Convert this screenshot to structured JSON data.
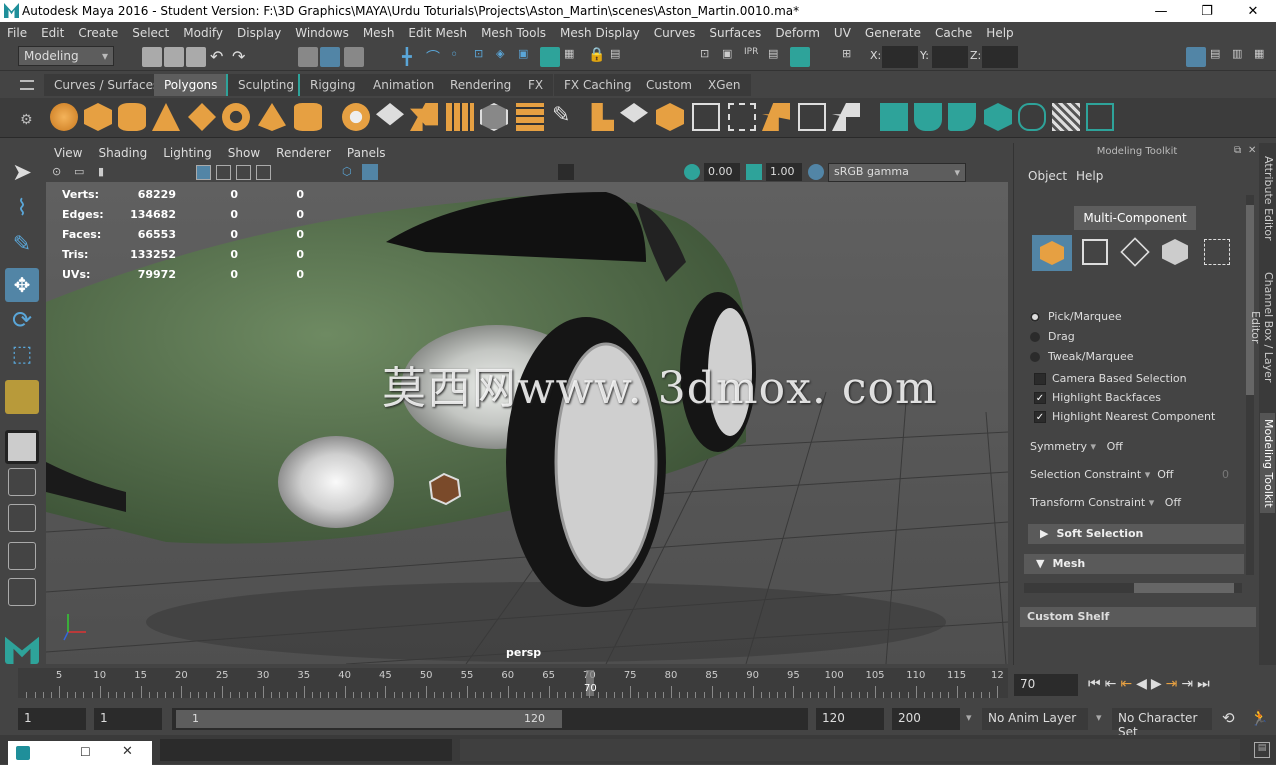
{
  "window": {
    "title": "Autodesk Maya 2016 - Student Version: F:\\3D Graphics\\MAYA\\Urdu Toturials\\Projects\\Aston_Martin\\scenes\\Aston_Martin.0010.ma*",
    "minimize": "—",
    "maximize": "❐",
    "close": "✕"
  },
  "menus": [
    "File",
    "Edit",
    "Create",
    "Select",
    "Modify",
    "Display",
    "Windows",
    "Mesh",
    "Edit Mesh",
    "Mesh Tools",
    "Mesh Display",
    "Curves",
    "Surfaces",
    "Deform",
    "UV",
    "Generate",
    "Cache",
    "Help"
  ],
  "status": {
    "mode": "Modeling",
    "x_label": "X:",
    "y_label": "Y:",
    "z_label": "Z:"
  },
  "shelf_tabs": [
    "Curves / Surfaces",
    "Polygons",
    "Sculpting",
    "Rigging",
    "Animation",
    "Rendering",
    "FX",
    "FX Caching",
    "Custom",
    "XGen"
  ],
  "viewport": {
    "menus": [
      "View",
      "Shading",
      "Lighting",
      "Show",
      "Renderer",
      "Panels"
    ],
    "exposure": "0.00",
    "gamma": "1.00",
    "colorspace": "sRGB gamma",
    "hud": [
      {
        "label": "Verts:",
        "v": "68229",
        "a": "0",
        "b": "0"
      },
      {
        "label": "Edges:",
        "v": "134682",
        "a": "0",
        "b": "0"
      },
      {
        "label": "Faces:",
        "v": "66553",
        "a": "0",
        "b": "0"
      },
      {
        "label": "Tris:",
        "v": "133252",
        "a": "0",
        "b": "0"
      },
      {
        "label": "UVs:",
        "v": "79972",
        "a": "0",
        "b": "0"
      }
    ],
    "camera": "persp",
    "watermark": "莫西网www. 3dmox. com"
  },
  "toolkit": {
    "title": "Modeling Toolkit",
    "menus": [
      "Object",
      "Help"
    ],
    "mode_button": "Multi-Component",
    "pick": "Pick/Marquee",
    "drag": "Drag",
    "tweak": "Tweak/Marquee",
    "camera_sel": "Camera Based Selection",
    "backfaces": "Highlight Backfaces",
    "nearest": "Highlight Nearest Component",
    "symmetry_label": "Symmetry",
    "symmetry_value": "Off",
    "sel_constraint_label": "Selection Constraint",
    "sel_constraint_value": "Off",
    "sel_constraint_num": "0",
    "xf_constraint_label": "Transform Constraint",
    "xf_constraint_value": "Off",
    "soft_selection": "Soft Selection",
    "mesh": "Mesh",
    "custom_shelf": "Custom Shelf"
  },
  "sidetabs": [
    "Attribute Editor",
    "Channel Box / Layer Editor",
    "Modeling Toolkit"
  ],
  "timeline": {
    "ticks": [
      "5",
      "10",
      "15",
      "20",
      "25",
      "30",
      "35",
      "40",
      "45",
      "50",
      "55",
      "60",
      "65",
      "70",
      "75",
      "80",
      "85",
      "90",
      "95",
      "100",
      "105",
      "110",
      "115",
      "12"
    ],
    "current": "70",
    "current_field": "70"
  },
  "range": {
    "start": "1",
    "start2": "1",
    "slider_start": "1",
    "slider_end": "120",
    "end": "120",
    "end2": "200",
    "anim_layer": "No Anim Layer",
    "char_set": "No Character Set"
  },
  "colors": {
    "accent": "#5285a6",
    "orange": "#e6a042",
    "teal": "#2ea39a"
  }
}
